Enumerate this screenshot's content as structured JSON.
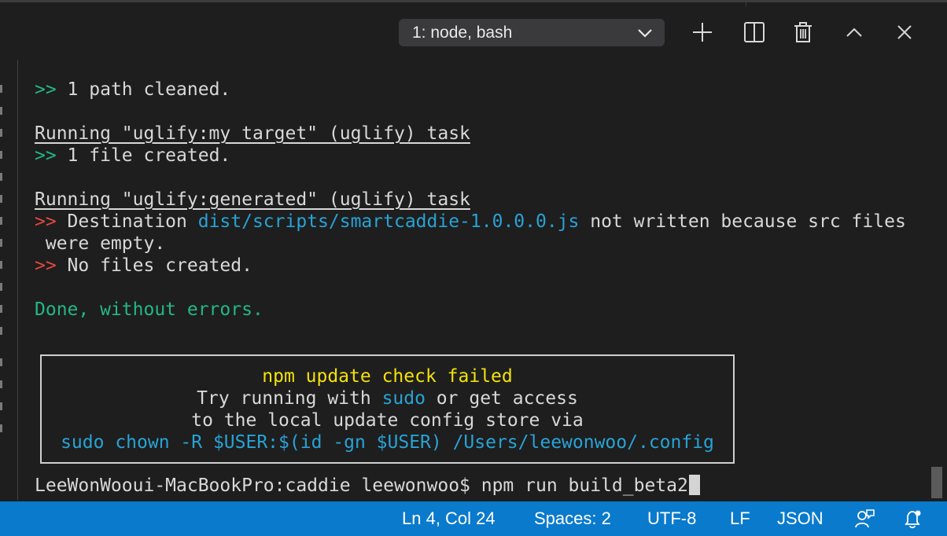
{
  "panel": {
    "terminal_selector": "1: node, bash"
  },
  "terminal": {
    "lines": {
      "l1_prompt": ">>",
      "l1_text": " 1 path cleaned.",
      "l2_text": "Running \"uglify:my_target\" (uglify) task",
      "l3_prompt": ">>",
      "l3_text": " 1 file created.",
      "l4_text": "Running \"uglify:generated\" (uglify) task",
      "l5_prompt": ">>",
      "l5_pre": " Destination ",
      "l5_path": "dist/scripts/smartcaddie-1.0.0.0.js",
      "l5_post": " not written because src files",
      "l6_text": " were empty.",
      "l7_prompt": ">>",
      "l7_text": " No files created.",
      "l8_text": "Done, without errors."
    },
    "npm_box": {
      "line1": "npm update check failed",
      "line2_pre": "Try running with ",
      "line2_sudo": "sudo",
      "line2_post": " or get access",
      "line3": "to the local update config store via",
      "line4": "sudo chown -R $USER:$(id -gn $USER) /Users/leewonwoo/.config"
    },
    "prompt": {
      "text": "LeeWonWooui-MacBookPro:caddie leewonwoo$ npm run build_beta2"
    }
  },
  "status_bar": {
    "position": "Ln 4, Col 24",
    "spaces": "Spaces: 2",
    "encoding": "UTF-8",
    "eol": "LF",
    "language": "JSON"
  },
  "colors": {
    "background": "#1e1e1e",
    "status_bar": "#0a7acc",
    "green": "#23b787",
    "red": "#e2483d",
    "cyan": "#27a3d6",
    "yellow": "#f3e10a"
  },
  "icons": {
    "selector_chevron": "chevron-down-icon",
    "new_terminal": "plus-icon",
    "split_terminal": "split-icon",
    "kill_terminal": "trash-icon",
    "maximize_panel": "chevron-up-icon",
    "close_panel": "close-icon",
    "feedback": "feedback-icon",
    "notifications": "bell-icon"
  }
}
